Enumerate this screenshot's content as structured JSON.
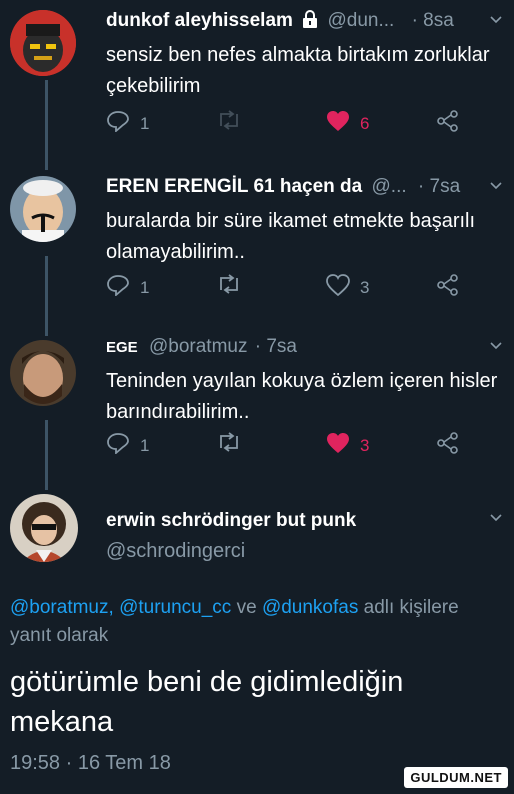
{
  "tweets": [
    {
      "name": "dunkof aleyhisselam",
      "handle": "@dun...",
      "time": "· 8sa",
      "text": "sensiz ben nefes almakta birtakım zorluklar çekebilirim",
      "replies": "1",
      "retweets": "",
      "likes": "6",
      "liked": true
    },
    {
      "name": "EREN ERENGİL 61 haçen da",
      "handle": "@...",
      "time": "· 7sa",
      "text": "buralarda bir süre ikamet etmekte başarılı olamayabilirim..",
      "replies": "1",
      "retweets": "",
      "likes": "3",
      "liked": false
    },
    {
      "name": "EGE",
      "handle": "@boratmuz",
      "time": "· 7sa",
      "text": "Teninden yayılan kokuya özlem içeren hisler barındırabilirim..",
      "replies": "1",
      "retweets": "",
      "likes": "3",
      "liked": true
    }
  ],
  "main_tweet": {
    "name": "erwin schrödinger but punk",
    "handle": "@schrodingerci",
    "reply_to": {
      "mentions": [
        "@boratmuz,",
        "@turuncu_cc",
        "@dunkofas"
      ],
      "connector": "ve",
      "suffix": "adlı kişilere yanıt olarak"
    },
    "text": "götürümle beni de gidimlediğin mekana",
    "timestamp": "19:58 · 16 Tem 18"
  },
  "watermark": "GULDUM.NET",
  "colors": {
    "background": "#141d26",
    "secondary_text": "#8899a6",
    "link": "#1da1f2",
    "like": "#e0245e",
    "thread_line": "#3d5466"
  },
  "icons": [
    "lock-icon",
    "chevron-down-icon",
    "reply-icon",
    "retweet-icon",
    "heart-icon",
    "share-icon"
  ]
}
